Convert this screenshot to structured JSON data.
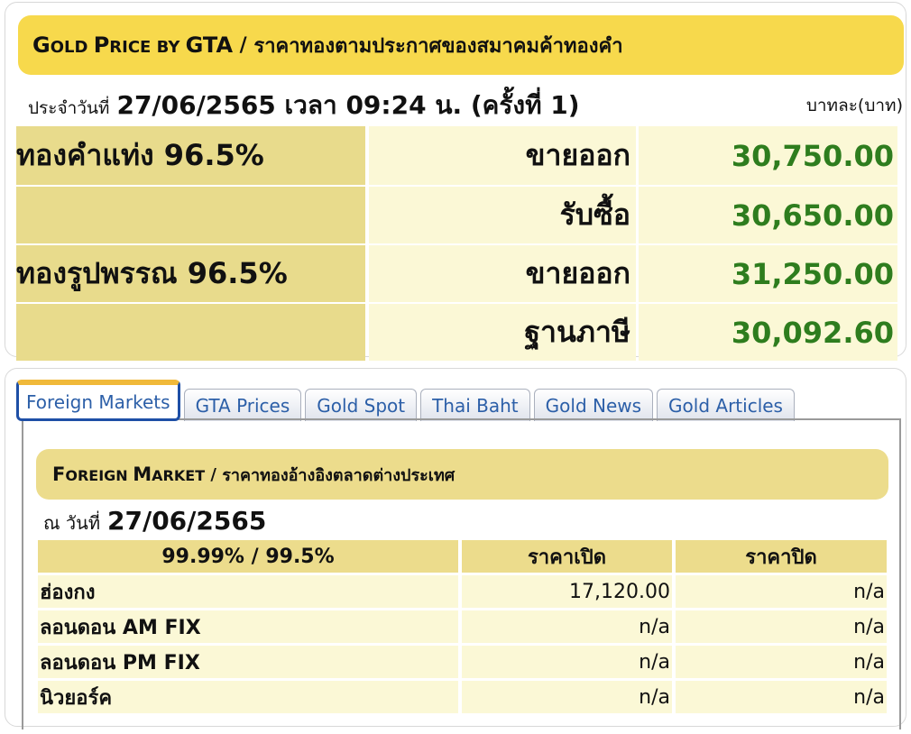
{
  "gta_panel": {
    "title_en_parts": [
      {
        "big": "G",
        "small": "OLD "
      },
      {
        "big": "P",
        "small": "RICE BY "
      },
      {
        "big": "GTA",
        "small": ""
      }
    ],
    "title_separator": " / ",
    "title_th": "ราคาทองตามประกาศของสมาคมค้าทองคำ",
    "date_label": "ประจำวันที่",
    "date_value": "27/06/2565 เวลา 09:24 น. (ครั้งที่ 1)",
    "unit_label": "บาทละ(บาท)",
    "rows": [
      {
        "type": "ทองคำแท่ง 96.5%",
        "action": "ขายออก",
        "price": "30,750.00"
      },
      {
        "type": "",
        "action": "รับซื้อ",
        "price": "30,650.00"
      },
      {
        "type": "ทองรูปพรรณ 96.5%",
        "action": "ขายออก",
        "price": "31,250.00"
      },
      {
        "type": "",
        "action": "ฐานภาษี",
        "price": "30,092.60"
      }
    ],
    "price_color": "#2e7d1e"
  },
  "tabs": [
    {
      "label": "Foreign Markets",
      "active": true
    },
    {
      "label": "GTA Prices",
      "active": false
    },
    {
      "label": "Gold Spot",
      "active": false
    },
    {
      "label": "Thai Baht",
      "active": false
    },
    {
      "label": "Gold News",
      "active": false
    },
    {
      "label": "Gold Articles",
      "active": false
    }
  ],
  "foreign_market": {
    "title_en_parts": [
      {
        "big": "F",
        "small": "OREIGN "
      },
      {
        "big": "M",
        "small": "ARKET"
      }
    ],
    "title_separator": " / ",
    "title_th": "ราคาทองอ้างอิงตลาดต่างประเทศ",
    "date_label": "ณ วันที่",
    "date_value": "27/06/2565",
    "headers": [
      "99.99% / 99.5%",
      "ราคาเปิด",
      "ราคาปิด"
    ],
    "rows": [
      {
        "market": "ฮ่องกง",
        "open": "17,120.00",
        "close": "n/a"
      },
      {
        "market": "ลอนดอน AM FIX",
        "open": "n/a",
        "close": "n/a"
      },
      {
        "market": "ลอนดอน PM FIX",
        "open": "n/a",
        "close": "n/a"
      },
      {
        "market": "นิวยอร์ค",
        "open": "n/a",
        "close": "n/a"
      }
    ]
  }
}
